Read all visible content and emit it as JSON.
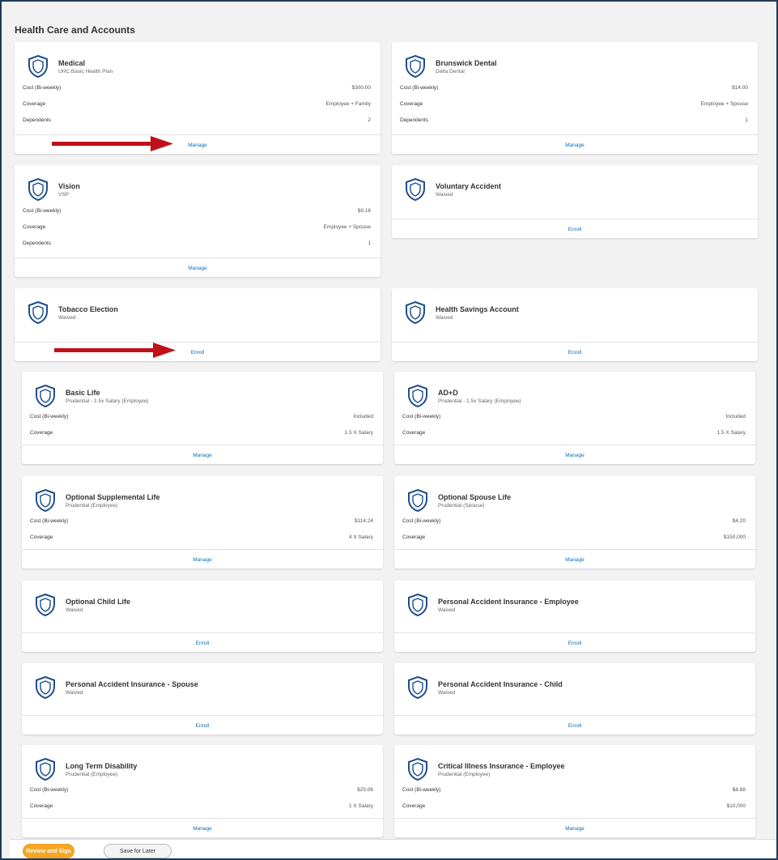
{
  "page": {
    "title": "Health Care and Accounts"
  },
  "labels": {
    "cost": "Cost (Bi-weekly)",
    "coverage": "Coverage",
    "dependents": "Dependents"
  },
  "cards": {
    "medical": {
      "title": "Medical",
      "subtitle": "UHC Basic Health Plan",
      "cost": "$300.00",
      "coverage": "Employee + Family",
      "dependents": "2",
      "action": "Manage"
    },
    "dental": {
      "title": "Brunswick Dental",
      "subtitle": "Delta Dental",
      "cost": "$14.00",
      "coverage": "Employee + Spouse",
      "dependents": "1",
      "action": "Manage"
    },
    "vision": {
      "title": "Vision",
      "subtitle": "VSP",
      "cost": "$9.16",
      "coverage": "Employee + Spouse",
      "dependents": "1",
      "action": "Manage"
    },
    "voluntary_accident": {
      "title": "Voluntary Accident",
      "subtitle": "Waived",
      "action": "Enroll"
    },
    "tobacco": {
      "title": "Tobacco Election",
      "subtitle": "Waived",
      "action": "Enroll"
    },
    "hsa": {
      "title": "Health Savings Account",
      "subtitle": "Waived",
      "action": "Enroll"
    },
    "basic_life": {
      "title": "Basic Life",
      "subtitle": "Prudential - 1.5x Salary (Employee)",
      "cost": "Included",
      "coverage": "1.5 X Salary",
      "action": "Manage"
    },
    "add": {
      "title": "AD+D",
      "subtitle": "Prudential - 1.5x Salary (Employee)",
      "cost": "Included",
      "coverage": "1.5 X Salary",
      "action": "Manage"
    },
    "opt_supp_life": {
      "title": "Optional Supplemental Life",
      "subtitle": "Prudential (Employee)",
      "cost": "$114.24",
      "coverage": "4 X Salary",
      "action": "Manage"
    },
    "opt_spouse_life": {
      "title": "Optional Spouse Life",
      "subtitle": "Prudential (Spouse)",
      "cost": "$4.20",
      "coverage": "$150,000",
      "action": "Manage"
    },
    "opt_child_life": {
      "title": "Optional Child Life",
      "subtitle": "Waived",
      "action": "Enroll"
    },
    "pai_employee": {
      "title": "Personal Accident Insurance - Employee",
      "subtitle": "Waived",
      "action": "Enroll"
    },
    "pai_spouse": {
      "title": "Personal Accident Insurance - Spouse",
      "subtitle": "Waived",
      "action": "Enroll"
    },
    "pai_child": {
      "title": "Personal Accident Insurance - Child",
      "subtitle": "Waived",
      "action": "Enroll"
    },
    "ltd": {
      "title": "Long Term Disability",
      "subtitle": "Prudential (Employee)",
      "cost": "$25.06",
      "coverage": "1 X Salary",
      "action": "Manage"
    },
    "critical_illness": {
      "title": "Critical Illness Insurance - Employee",
      "subtitle": "Prudential (Employee)",
      "cost": "$8.88",
      "coverage": "$10,000",
      "action": "Manage"
    }
  },
  "footer": {
    "primary": "Review and Sign",
    "secondary": "Save for Later"
  },
  "colors": {
    "accent": "#0a6fb5",
    "arrow": "#c0111b",
    "primary_button": "#f5a623",
    "frame": "#1f3a5c"
  }
}
